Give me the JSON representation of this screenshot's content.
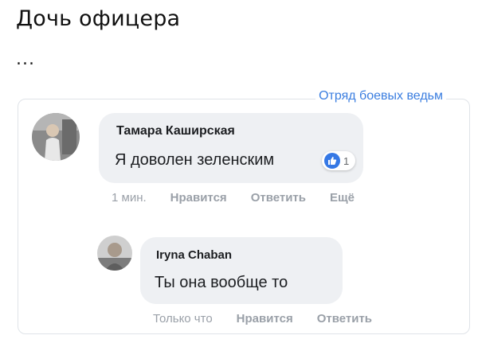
{
  "post": {
    "title": "Дочь офицера",
    "ellipsis": "..."
  },
  "group": {
    "label": "Отряд боевых ведьм"
  },
  "comments": [
    {
      "author": "Тамара Каширская",
      "text": "Я доволен зеленским",
      "reaction": {
        "icon": "thumbs-up-icon",
        "count": "1"
      },
      "meta": {
        "time": "1 мин.",
        "like": "Нравится",
        "reply": "Ответить",
        "more": "Ещё"
      }
    },
    {
      "author": "Iryna Chaban",
      "text": "Ты она вообще то",
      "meta": {
        "time": "Только что",
        "like": "Нравится",
        "reply": "Ответить"
      }
    }
  ],
  "colors": {
    "accent": "#3b7ee0",
    "bubble": "#eef0f3",
    "meta": "#9aa0a8",
    "like_badge": "#3578e5"
  }
}
